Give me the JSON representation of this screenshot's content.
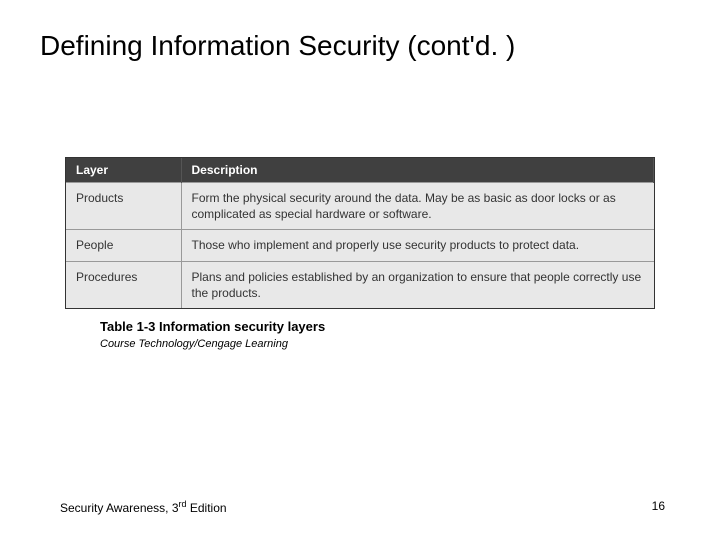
{
  "title": "Defining Information Security (cont'd. )",
  "table": {
    "headers": {
      "col1": "Layer",
      "col2": "Description"
    },
    "rows": [
      {
        "layer": "Products",
        "desc": "Form the physical security around the data. May be as basic as door locks or as complicated as special hardware or software."
      },
      {
        "layer": "People",
        "desc": "Those who implement and properly use security products to protect data."
      },
      {
        "layer": "Procedures",
        "desc": "Plans and policies established by an organization to ensure that people correctly use the products."
      }
    ]
  },
  "caption": "Table 1-3 Information security layers",
  "source": "Course Technology/Cengage Learning",
  "footer": {
    "left_prefix": "Security Awareness, 3",
    "left_sup": "rd",
    "left_suffix": " Edition",
    "page": "16"
  }
}
